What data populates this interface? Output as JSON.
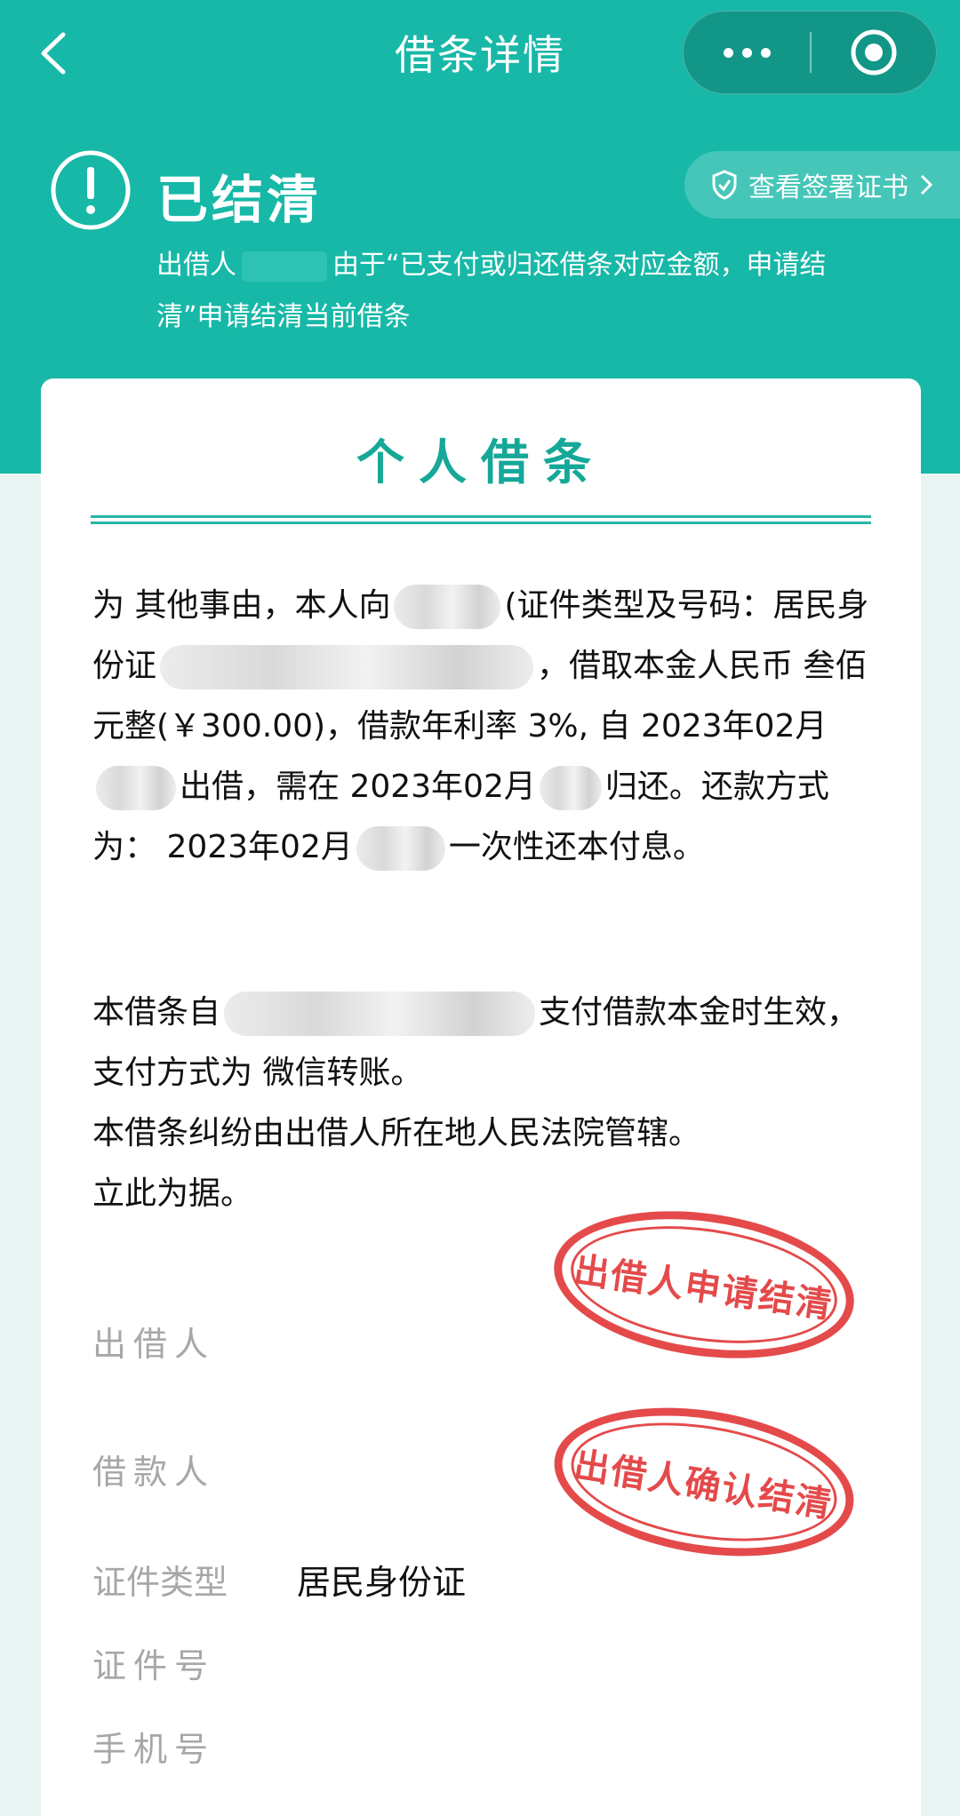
{
  "nav": {
    "title": "借条详情"
  },
  "status": {
    "title": "已结清",
    "cert_label": "查看签署证书",
    "desc_prefix": "出借人",
    "desc_suffix": "由于“已支付或归还借条对应金额，申请结清”申请结清当前借条"
  },
  "doc": {
    "title": "个人借条",
    "p1": {
      "t1": "为 其他事由，本人向",
      "t2": "(证件类型及号码：居民身份证",
      "t3": "，借取本金人民币 叁佰元整(￥300.00)，借款年利率 3%, 自 2023年02月",
      "t4": "出借，需在 2023年02月",
      "t5": "归还。还款方式为： 2023年02月",
      "t6": "一次性还本付息。"
    },
    "p2": {
      "t1": "本借条自",
      "t2": "支付借款本金时生效，支付方式为 微信转账。",
      "t3": "本借条纠纷由出借人所在地人民法院管辖。",
      "t4": "立此为据。"
    }
  },
  "fields": {
    "lender_label": "出借人",
    "borrower_label": "借款人",
    "id_type_label": "证件类型",
    "id_type_value": "居民身份证",
    "id_no_label": "证件号",
    "phone_label": "手机号"
  },
  "stamps": {
    "stamp1": "出借人申请结清",
    "stamp2": "出借人确认结清"
  },
  "colors": {
    "primary": "#17b8a7",
    "stamp": "#e23b3b"
  }
}
